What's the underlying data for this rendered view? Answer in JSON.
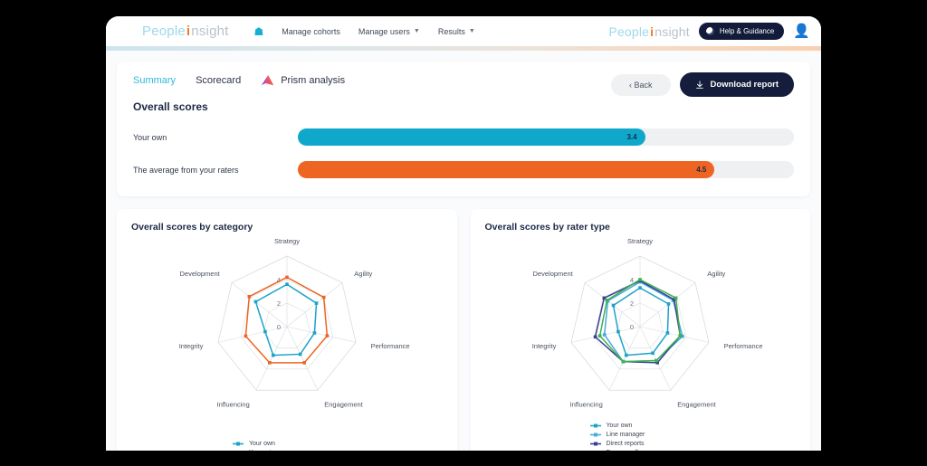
{
  "brand": {
    "part1": "People",
    "part2": "i",
    "part3": "nsight"
  },
  "navbar": {
    "home_icon": "home-icon",
    "links": [
      {
        "label": "Manage cohorts",
        "caret": false
      },
      {
        "label": "Manage users",
        "caret": true
      },
      {
        "label": "Results",
        "caret": true
      }
    ],
    "help_label": "Help & Guidance",
    "avatar": "user-avatar"
  },
  "tabs": [
    {
      "label": "Summary",
      "active": true
    },
    {
      "label": "Scorecard",
      "active": false
    },
    {
      "label": "Prism analysis",
      "active": false,
      "icon": "prism-icon"
    }
  ],
  "actions": {
    "back_label": "‹ Back",
    "download_label": "Download  report"
  },
  "overall": {
    "title": "Overall scores",
    "bars": [
      {
        "label": "Your own",
        "value": "3.4",
        "pct": 70,
        "color": "#0fa8cb"
      },
      {
        "label": "The average from your raters",
        "value": "4.5",
        "pct": 84,
        "color": "#ee6422"
      }
    ]
  },
  "chart_data": [
    {
      "type": "radar",
      "title": "Overall scores by category",
      "categories": [
        "Strategy",
        "Agility",
        "Performance",
        "Engagement",
        "Influencing",
        "Integrity",
        "Development"
      ],
      "ticks": [
        0,
        2,
        4
      ],
      "rmax": 6,
      "grid": true,
      "legend_position": "bottom",
      "series": [
        {
          "name": "Your own",
          "color": "#1ba3c8",
          "values": [
            3.6,
            3.2,
            2.4,
            2.6,
            2.7,
            1.9,
            3.4
          ]
        },
        {
          "name": "Your raters",
          "color": "#ee6422",
          "values": [
            4.2,
            4.0,
            3.5,
            3.4,
            3.4,
            3.6,
            4.1
          ]
        }
      ]
    },
    {
      "type": "radar",
      "title": "Overall scores by rater type",
      "categories": [
        "Strategy",
        "Agility",
        "Performance",
        "Engagement",
        "Influencing",
        "Integrity",
        "Development"
      ],
      "ticks": [
        0,
        2,
        4
      ],
      "rmax": 6,
      "grid": true,
      "legend_position": "bottom",
      "series": [
        {
          "name": "Your own",
          "color": "#1ba3c8",
          "values": [
            3.3,
            3.1,
            2.4,
            2.5,
            2.7,
            1.9,
            2.9
          ]
        },
        {
          "name": "Line manager",
          "color": "#4aa8e0",
          "values": [
            3.8,
            3.6,
            3.7,
            3.2,
            3.3,
            3.1,
            3.5
          ]
        },
        {
          "name": "Direct reports",
          "color": "#3c3f94",
          "values": [
            3.9,
            3.7,
            3.5,
            3.4,
            3.3,
            3.9,
            3.9
          ]
        },
        {
          "name": "Peer or colleague",
          "color": "#3cb44a",
          "values": [
            4.0,
            3.9,
            3.5,
            3.2,
            3.3,
            3.5,
            3.6
          ]
        }
      ]
    }
  ]
}
